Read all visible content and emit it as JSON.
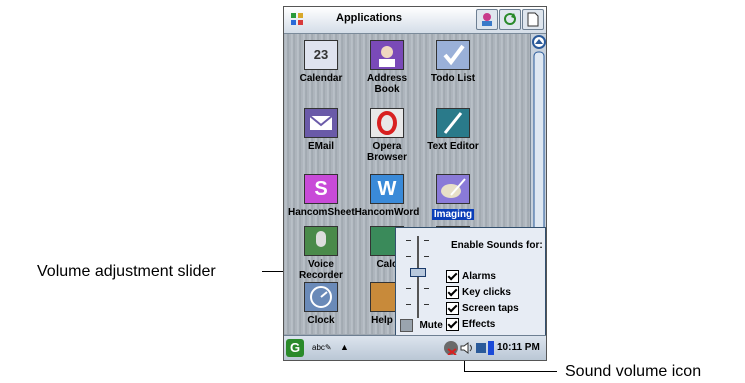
{
  "titlebar": {
    "title": "Applications"
  },
  "apps": [
    {
      "label": "Calendar",
      "icon": "calendar-icon",
      "color": "#4a5a9a"
    },
    {
      "label": "Address Book",
      "icon": "address-book-icon",
      "color": "#7a4ab8"
    },
    {
      "label": "Todo List",
      "icon": "todo-list-icon",
      "color": "#9ab0d8"
    },
    {
      "label": "EMail",
      "icon": "email-icon",
      "color": "#6a5aa8"
    },
    {
      "label": "Opera Browser",
      "icon": "opera-browser-icon",
      "color": "#d8d8d8"
    },
    {
      "label": "Text Editor",
      "icon": "text-editor-icon",
      "color": "#2a7a8a"
    },
    {
      "label": "HancomSheet",
      "icon": "hancomsheet-icon",
      "color": "#c84ad8"
    },
    {
      "label": "HancomWord",
      "icon": "hancomword-icon",
      "color": "#3a8ad8"
    },
    {
      "label": "Imaging",
      "icon": "imaging-icon",
      "color": "#8a7ad8"
    },
    {
      "label": "Voice Recorder",
      "icon": "voice-recorder-icon",
      "color": "#4a8a4a"
    },
    {
      "label": "Calc",
      "icon": "calculator-icon",
      "color": "#3a8a5a"
    },
    {
      "label": "",
      "icon": "app-icon",
      "color": "#2a9ab8"
    },
    {
      "label": "Clock",
      "icon": "clock-icon",
      "color": "#6a8ab8"
    },
    {
      "label": "Help B",
      "icon": "help-icon",
      "color": "#c88a3a"
    }
  ],
  "selected_app": "Imaging",
  "volume_popup": {
    "title": "Enable Sounds for:",
    "options": [
      {
        "label": "Alarms",
        "checked": true
      },
      {
        "label": "Key clicks",
        "checked": true
      },
      {
        "label": "Screen taps",
        "checked": true
      },
      {
        "label": "Effects",
        "checked": true
      }
    ],
    "mute_label": "Mute",
    "mute_checked": false
  },
  "taskbar": {
    "input_method": "abc",
    "clock": "10:11 PM"
  },
  "callouts": {
    "volume_slider": "Volume adjustment slider",
    "sound_icon": "Sound volume icon"
  }
}
